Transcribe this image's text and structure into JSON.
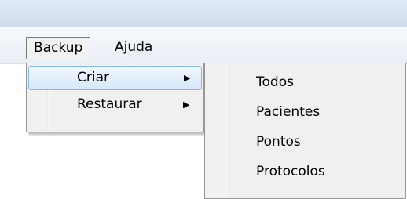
{
  "menubar": {
    "items": [
      {
        "label": "Backup"
      },
      {
        "label": "Ajuda"
      }
    ]
  },
  "backup_menu": {
    "items": [
      {
        "label": "Criar",
        "arrow": "▶"
      },
      {
        "label": "Restaurar",
        "arrow": "▶"
      }
    ]
  },
  "criar_submenu": {
    "items": [
      {
        "label": "Todos"
      },
      {
        "label": "Pacientes"
      },
      {
        "label": "Pontos"
      },
      {
        "label": "Protocolos"
      }
    ]
  }
}
